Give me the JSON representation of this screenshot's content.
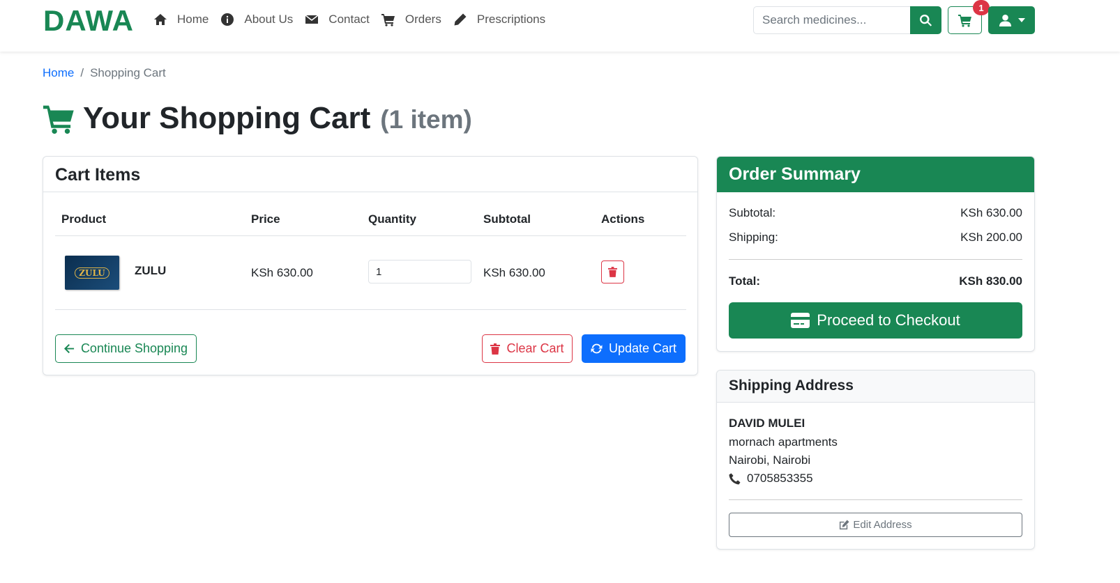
{
  "brand": "DAWA",
  "nav": {
    "home": "Home",
    "about": "About Us",
    "contact": "Contact",
    "orders": "Orders",
    "prescriptions": "Prescriptions"
  },
  "search": {
    "placeholder": "Search medicines..."
  },
  "cart_badge": "1",
  "breadcrumb": {
    "home": "Home",
    "sep": "/",
    "current": "Shopping Cart"
  },
  "page": {
    "title": "Your Shopping Cart",
    "count": "(1 item)"
  },
  "cart": {
    "header": "Cart Items",
    "columns": [
      "Product",
      "Price",
      "Quantity",
      "Subtotal",
      "Actions"
    ],
    "items": [
      {
        "image_text": "ZULU",
        "name": "ZULU",
        "price": "KSh 630.00",
        "quantity": "1",
        "subtotal": "KSh 630.00"
      }
    ],
    "continue_label": "Continue Shopping",
    "clear_label": "Clear Cart",
    "update_label": "Update Cart"
  },
  "summary": {
    "header": "Order Summary",
    "subtotal_label": "Subtotal:",
    "subtotal_value": "KSh 630.00",
    "shipping_label": "Shipping:",
    "shipping_value": "KSh 200.00",
    "total_label": "Total:",
    "total_value": "KSh 830.00",
    "checkout_label": "Proceed to Checkout"
  },
  "shipping": {
    "header": "Shipping Address",
    "name": "DAVID MULEI",
    "line1": "mornach apartments",
    "line2": "Nairobi, Nairobi",
    "phone": "0705853355",
    "edit_label": "Edit Address"
  },
  "colors": {
    "brand_green": "#198754",
    "primary_blue": "#0d6efd",
    "danger_red": "#dc3545"
  },
  "icons": [
    "home-icon",
    "info-icon",
    "envelope-icon",
    "cart-icon",
    "pencil-icon",
    "search-icon",
    "user-icon",
    "caret-down-icon",
    "trash-icon",
    "arrow-left-icon",
    "refresh-icon",
    "credit-card-icon",
    "phone-icon",
    "edit-icon"
  ]
}
